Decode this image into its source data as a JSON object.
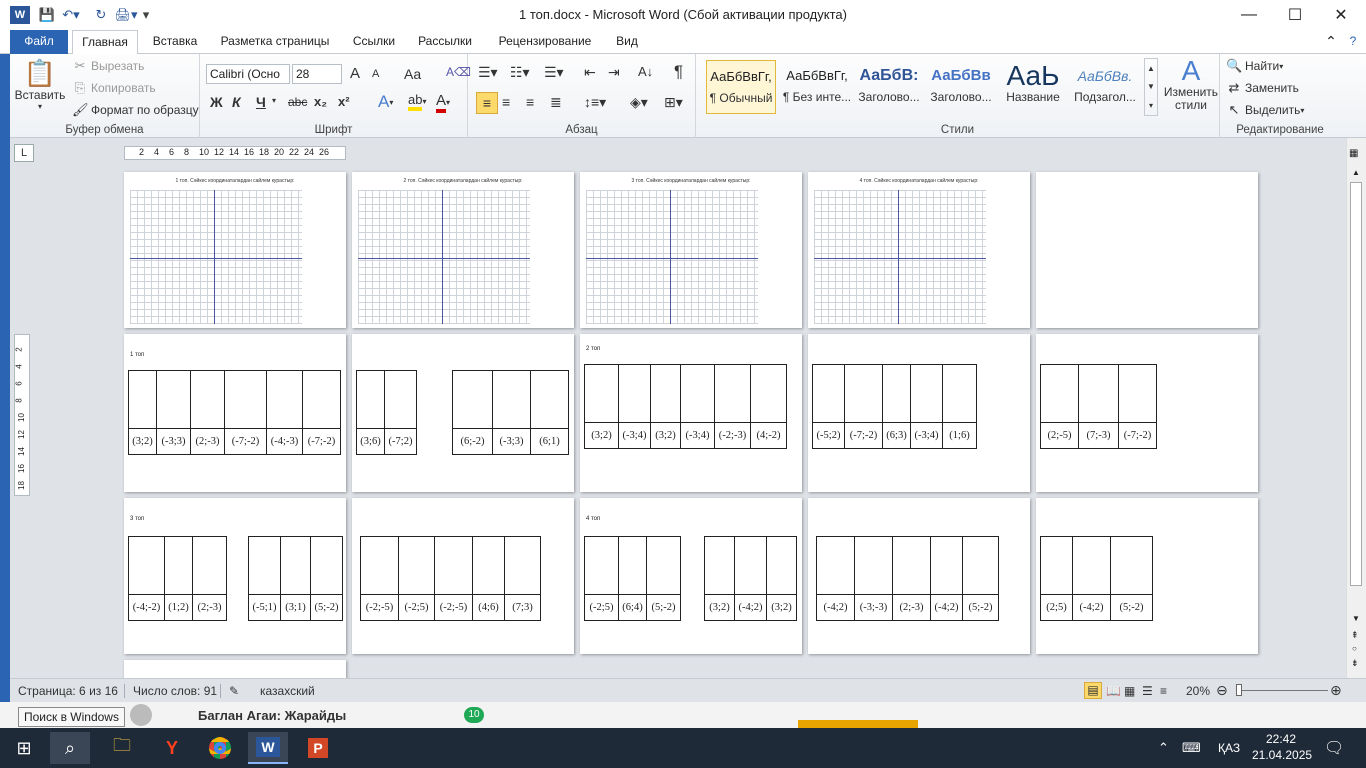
{
  "window": {
    "title": "1 топ.docx - Microsoft Word (Сбой активации продукта)",
    "minimize": "—",
    "maximize": "☐",
    "close": "✕"
  },
  "tabs": [
    "Файл",
    "Главная",
    "Вставка",
    "Разметка страницы",
    "Ссылки",
    "Рассылки",
    "Рецензирование",
    "Вид"
  ],
  "clipboard": {
    "paste": "Вставить",
    "cut": "Вырезать",
    "copy": "Копировать",
    "format_painter": "Формат по образцу",
    "label": "Буфер обмена"
  },
  "font": {
    "name": "Calibri (Осно",
    "size": "28",
    "label": "Шрифт",
    "bold": "Ж",
    "italic": "К",
    "underline": "Ч",
    "strike": "abc",
    "subscript": "x₂",
    "superscript": "x²",
    "grow": "A",
    "shrink": "A",
    "case": "Aa"
  },
  "paragraph": {
    "label": "Абзац",
    "pilcrow": "¶"
  },
  "styles": {
    "label": "Стили",
    "items": [
      {
        "sample": "АаБбВвГг,",
        "name": "¶ Обычный"
      },
      {
        "sample": "АаБбВвГг,",
        "name": "¶ Без инте..."
      },
      {
        "sample": "АаБбВ:",
        "name": "Заголово..."
      },
      {
        "sample": "АаБбВв",
        "name": "Заголово..."
      },
      {
        "sample": "АаЬ",
        "name": "Название"
      },
      {
        "sample": "АаБбВв.",
        "name": "Подзагол..."
      }
    ],
    "change": "Изменить стили"
  },
  "editing": {
    "label": "Редактирование",
    "find": "Найти",
    "replace": "Заменить",
    "select": "Выделить"
  },
  "ruler": [
    "2",
    "4",
    "6",
    "8",
    "10",
    "12",
    "14",
    "16",
    "18",
    "20",
    "22",
    "24",
    "26"
  ],
  "vruler": [
    "2",
    "4",
    "6",
    "8",
    "10",
    "12",
    "14",
    "16",
    "18"
  ],
  "pages_row1": [
    {
      "title": "1 топ. Сәйкес координаталардан сайлем курастыр:"
    },
    {
      "title": "2 топ. Сәйкес координаталардан сайлем курастыр:"
    },
    {
      "title": "3 топ. Сәйкес координаталардан сайлем курастыр:"
    },
    {
      "title": "4 топ. Сәйкес координаталардан сайлем курастыр:"
    }
  ],
  "labels": {
    "g1": "1 топ",
    "g2": "2 топ",
    "g3": "3 топ",
    "g4": "4 топ"
  },
  "row2": {
    "p1": [
      "(3;2)",
      "(-3;3)",
      "(2;-3)",
      "(-7;-2)",
      "(-4;-3)",
      "(-7;-2)"
    ],
    "p2a": [
      "(3;6)",
      "(-7;2)"
    ],
    "p2b": [
      "(6;-2)",
      "(-3;3)",
      "(6;1)"
    ],
    "p3": [
      "(3;2)",
      "(-3;4)",
      "(3;2)",
      "(-3;4)",
      "(-2;-3)",
      "(4;-2)"
    ],
    "p4": [
      "(-5;2)",
      "(-7;-2)",
      "(6;3)",
      "(-3;4)",
      "(1;6)"
    ],
    "p5": [
      "(2;-5)",
      "(7;-3)",
      "(-7;-2)"
    ]
  },
  "row3": {
    "p1a": [
      "(-4;-2)",
      "(1;2)",
      "(2;-3)"
    ],
    "p1b": [
      "(-5;1)",
      "(3;1)",
      "(5;-2)"
    ],
    "p2": [
      "(-2;-5)",
      "(-2;5)",
      "(-2;-5)",
      "(4;6)",
      "(7;3)"
    ],
    "p3a": [
      "(-2;5)",
      "(6;4)",
      "(5;-2)"
    ],
    "p3b": [
      "(3;2)",
      "(-4;2)",
      "(3;2)"
    ],
    "p4": [
      "(-4;2)",
      "(-3;-3)",
      "(2;-3)",
      "(-4;2)",
      "(5;-2)"
    ],
    "p5": [
      "(2;5)",
      "(-4;2)",
      "(5;-2)"
    ]
  },
  "status": {
    "page": "Страница: 6 из 16",
    "words": "Число слов: 91",
    "lang": "казахский",
    "zoom": "20%"
  },
  "background_app": {
    "text": "Баглан Агаи: Жарайды",
    "badge": "10"
  },
  "tooltip": "Поиск в Windows",
  "taskbar": {
    "lang": "ҚАЗ",
    "time": "22:42",
    "date": "21.04.2025"
  }
}
